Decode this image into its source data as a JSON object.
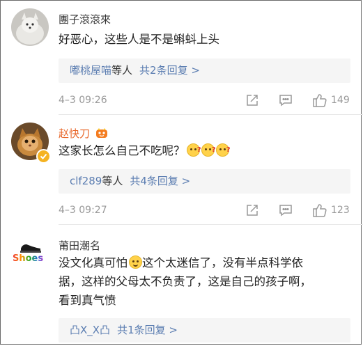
{
  "comments": [
    {
      "user": "團子滾滾來",
      "text": "好恶心，这些人是不是蝌蚪上头",
      "replies_names": "嘟桃屋喵",
      "replies_mid": "等人",
      "replies_count": "共2条回复 >",
      "time": "4–3 09:26",
      "likes": "149"
    },
    {
      "user": "赵快刀",
      "text": "这家长怎么自己不吃呢？",
      "replies_names": "clf289",
      "replies_mid": "等人",
      "replies_count": "共4条回复 >",
      "time": "4–3 09:27",
      "likes": "123"
    },
    {
      "user": "莆田潮名",
      "text_a": "没文化真可怕",
      "text_b": "这个太迷信了，没有半点科学依",
      "text_c": "据，这样的父母太不负责了，这是自己的孩子啊，",
      "text_d": "看到真气愤",
      "replies_names": "凸X_X凸",
      "replies_count": "共1条回复 >",
      "avatar_text": "Shoes"
    }
  ],
  "icons": [
    "share-icon",
    "comment-icon",
    "like-icon",
    "vip-badge-icon",
    "verified-badge-icon"
  ],
  "colors": {
    "reply_link": "#5b7db1",
    "vip_name": "#e8672a",
    "meta_gray": "#999999"
  }
}
